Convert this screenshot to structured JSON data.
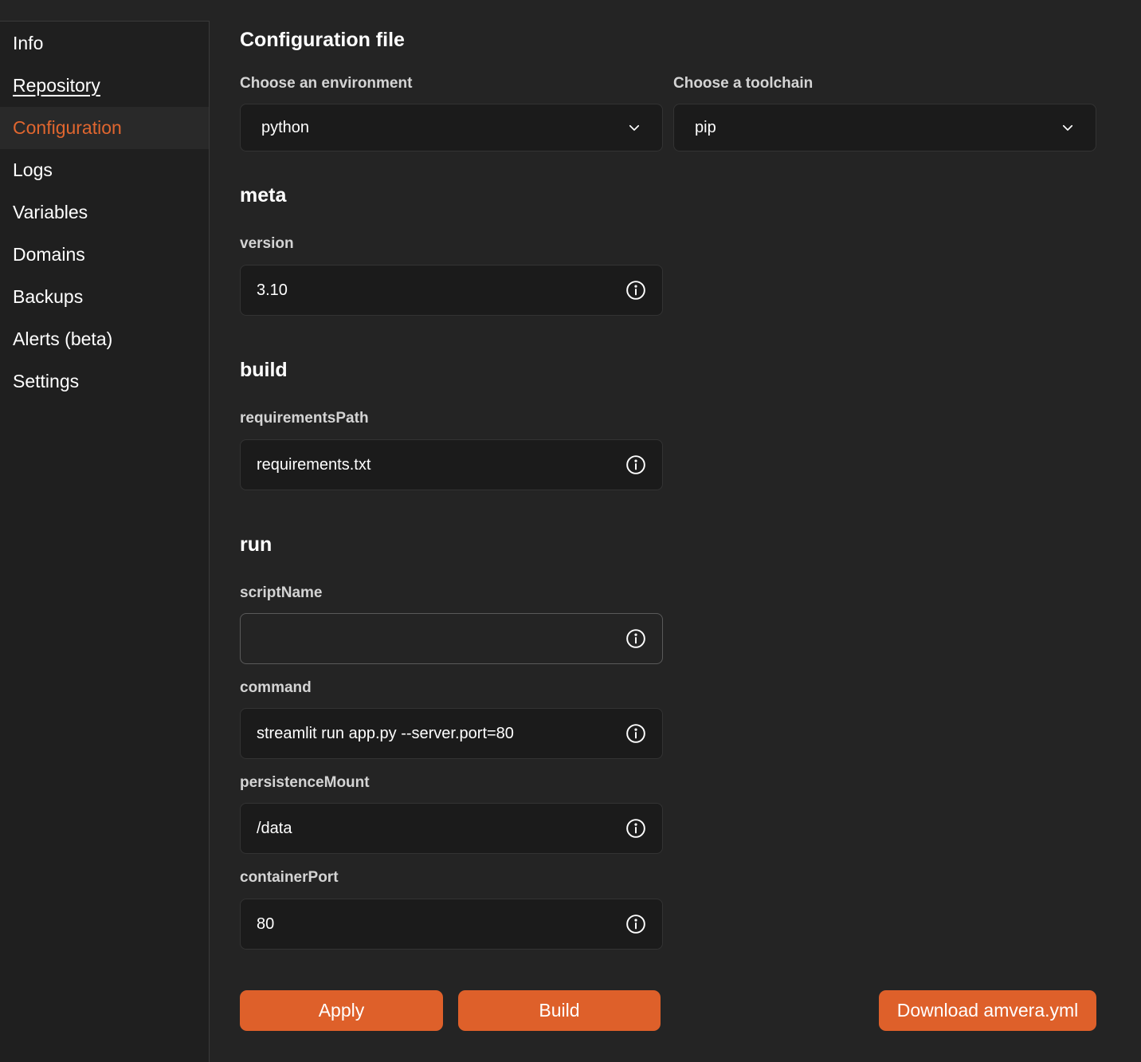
{
  "sidebar": {
    "items": [
      {
        "label": "Info"
      },
      {
        "label": "Repository"
      },
      {
        "label": "Configuration"
      },
      {
        "label": "Logs"
      },
      {
        "label": "Variables"
      },
      {
        "label": "Domains"
      },
      {
        "label": "Backups"
      },
      {
        "label": "Alerts (beta)"
      },
      {
        "label": "Settings"
      }
    ],
    "active_item": "Configuration"
  },
  "main": {
    "title": "Configuration file",
    "environment": {
      "label": "Choose an environment",
      "value": "python"
    },
    "toolchain": {
      "label": "Choose a toolchain",
      "value": "pip"
    },
    "sections": {
      "meta": {
        "title": "meta",
        "fields": {
          "version": {
            "label": "version",
            "value": "3.10"
          }
        }
      },
      "build": {
        "title": "build",
        "fields": {
          "requirementsPath": {
            "label": "requirementsPath",
            "value": "requirements.txt"
          }
        }
      },
      "run": {
        "title": "run",
        "fields": {
          "scriptName": {
            "label": "scriptName",
            "value": ""
          },
          "command": {
            "label": "command",
            "value": "streamlit run app.py --server.port=80"
          },
          "persistenceMount": {
            "label": "persistenceMount",
            "value": "/data"
          },
          "containerPort": {
            "label": "containerPort",
            "value": "80"
          }
        }
      }
    },
    "buttons": {
      "apply": "Apply",
      "build": "Build",
      "download": "Download amvera.yml"
    }
  },
  "colors": {
    "accent": "#de602a",
    "active_nav": "#e0662f",
    "background": "#242424",
    "sidebar": "#1f1f1f",
    "field_bg": "#1b1b1b"
  },
  "icons": {
    "field_info": "info-circle-icon",
    "select_chevron": "chevron-down-icon"
  }
}
